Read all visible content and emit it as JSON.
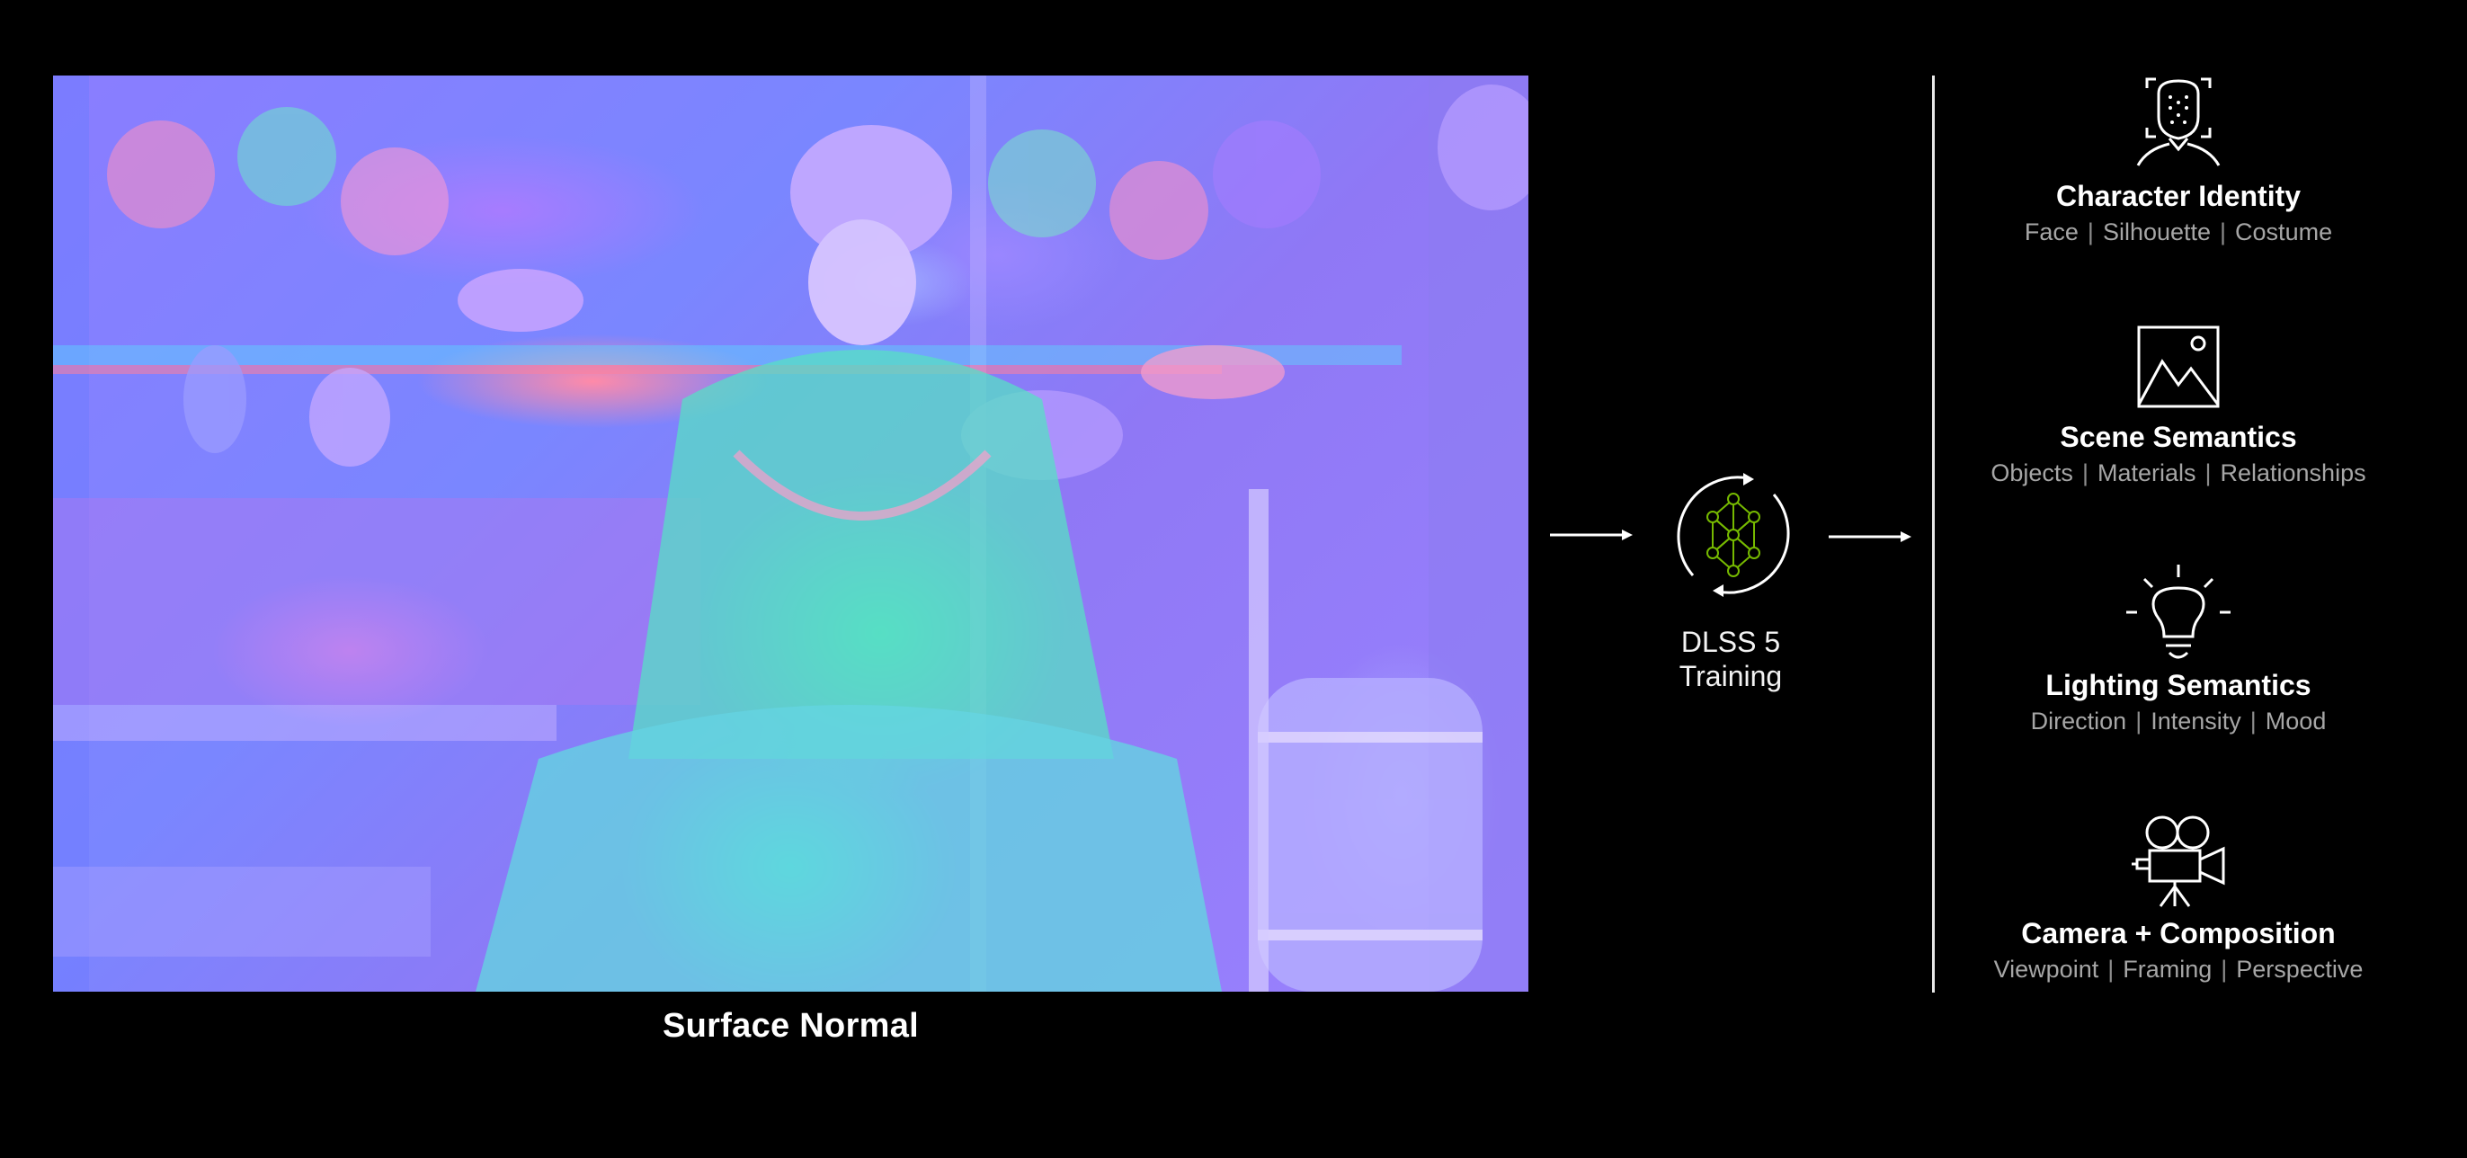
{
  "image": {
    "caption": "Surface Normal"
  },
  "process": {
    "label_line1": "DLSS 5",
    "label_line2": "Training",
    "icon": "neural-network-cycle-icon",
    "accent_color": "#76b900"
  },
  "outputs": [
    {
      "icon": "face-scan-icon",
      "title": "Character Identity",
      "items": [
        "Face",
        "Silhouette",
        "Costume"
      ]
    },
    {
      "icon": "image-landscape-icon",
      "title": "Scene Semantics",
      "items": [
        "Objects",
        "Materials",
        "Relationships"
      ]
    },
    {
      "icon": "lightbulb-icon",
      "title": "Lighting Semantics",
      "items": [
        "Direction",
        "Intensity",
        "Mood"
      ]
    },
    {
      "icon": "movie-camera-icon",
      "title": "Camera + Composition",
      "items": [
        "Viewpoint",
        "Framing",
        "Perspective"
      ]
    }
  ],
  "colors": {
    "background": "#000000",
    "text": "#ffffff",
    "subtext": "#a6a6a6"
  }
}
